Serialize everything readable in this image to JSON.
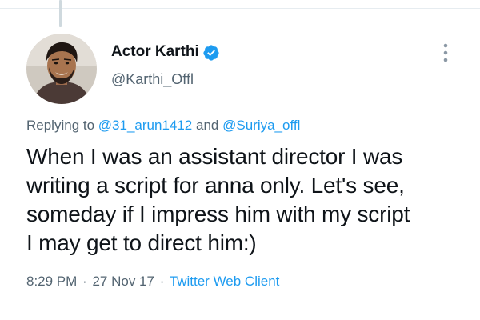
{
  "author": {
    "name": "Actor Karthi",
    "handle": "@Karthi_Offl",
    "verified": true,
    "verified_color": "#1d9bf0"
  },
  "reply_context": {
    "prefix": "Replying to",
    "mention_1": "@31_arun1412",
    "conjunction": "and",
    "mention_2": "@Suriya_offl"
  },
  "tweet": {
    "text_lines": [
      "When I was an assistant director I was",
      "writing a script for anna only. Let's see,",
      "someday if I impress him with my script",
      "I may get to direct him:)"
    ]
  },
  "meta": {
    "time": "8:29 PM",
    "separator": "·",
    "date": "27 Nov 17",
    "source": "Twitter Web Client"
  },
  "icons": {
    "verified": "verified-badge-icon",
    "more": "more-options-icon"
  },
  "colors": {
    "link": "#1d9bf0",
    "secondary_text": "#536471",
    "primary_text": "#0f1419"
  }
}
